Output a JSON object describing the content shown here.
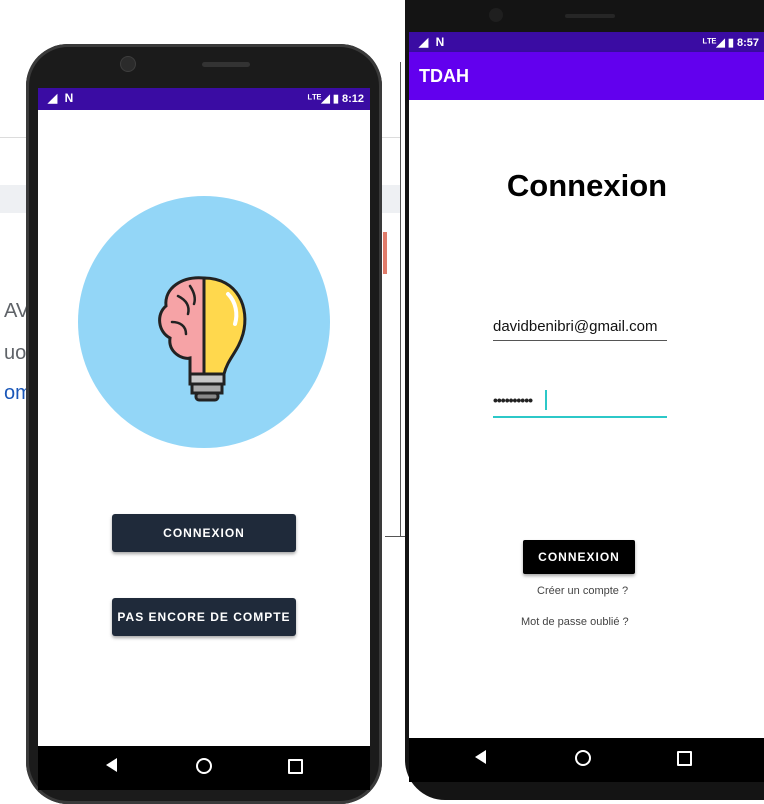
{
  "background": {
    "fragments": [
      "AV",
      "uo",
      "om"
    ]
  },
  "phone1": {
    "status": {
      "left": "◢ N",
      "right": "ᴸᵀᴱ◢ ▮ 8:12"
    },
    "buttons": {
      "login": "CONNEXION",
      "signup": "PAS ENCORE DE COMPTE"
    },
    "logo_icon": "brain-lightbulb-icon"
  },
  "phone2": {
    "status": {
      "left": "◢ N",
      "right": "ᴸᵀᴱ◢ ▮ 8:57"
    },
    "appbar_title": "TDAH",
    "title": "Connexion",
    "email_value": "davidbenibri@gmail.com",
    "password_value": "••••••••••",
    "login_button": "CONNEXION",
    "create_account_link": "Créer un compte ?",
    "forgot_password_link": "Mot de passe oublié ?"
  },
  "colors": {
    "status_bar": "#3a0ca3",
    "app_bar": "#6200ee",
    "button_dark": "#1f2a3a",
    "logo_bg": "#93d6f7",
    "input_focus": "#2cc8c8"
  }
}
